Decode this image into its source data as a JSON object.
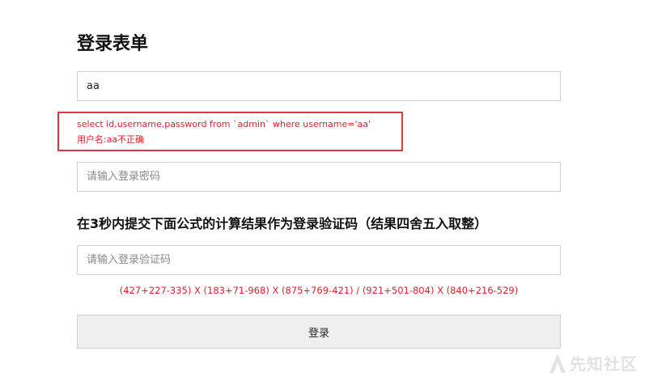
{
  "form": {
    "title": "登录表单",
    "username_value": "aa",
    "password_placeholder": "请输入登录密码",
    "captcha_placeholder": "请输入登录验证码",
    "login_label": "登录"
  },
  "error": {
    "sql": "select id,username,password from `admin` where username='aa'",
    "message": "用户名:aa不正确",
    "highlight_color": "#e0363c"
  },
  "captcha": {
    "heading": "在3秒内提交下面公式的计算结果作为登录验证码（结果四舍五入取整）",
    "formula": "(427+227-335) X (183+71-968) X (875+769-421) / (921+501-804) X (840+216-529)"
  },
  "watermark": {
    "text": "先知社区"
  }
}
